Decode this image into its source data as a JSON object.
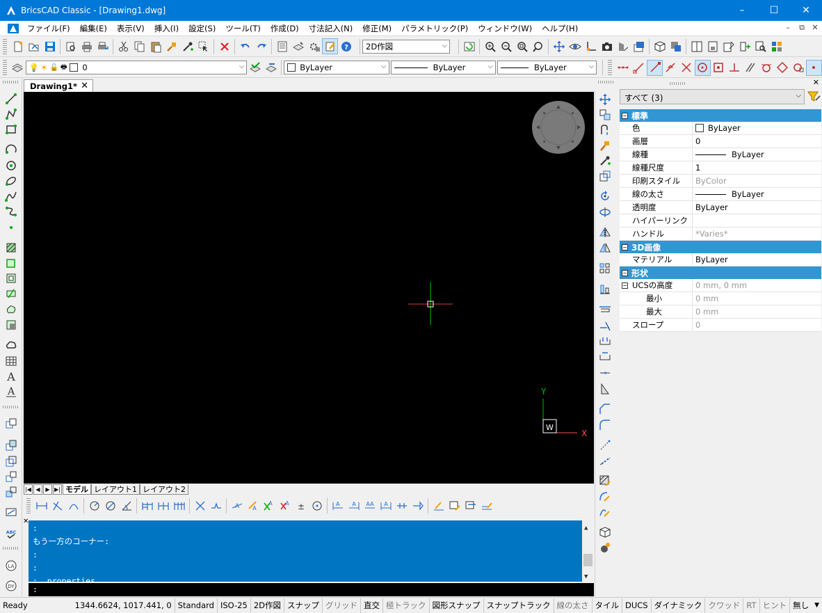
{
  "window": {
    "title": "BricsCAD Classic - [Drawing1.dwg]",
    "minimize": "–",
    "maximize": "☐",
    "close": "✕"
  },
  "menu": {
    "items": [
      "ファイル(F)",
      "編集(E)",
      "表示(V)",
      "挿入(I)",
      "設定(S)",
      "ツール(T)",
      "作成(D)",
      "寸法記入(N)",
      "修正(M)",
      "パラメトリック(P)",
      "ウィンドウ(W)",
      "ヘルプ(H)"
    ],
    "mdi_minimize": "–",
    "mdi_restore": "⧉",
    "mdi_close": "✕"
  },
  "toolbar": {
    "workspace": "2D作図"
  },
  "layerbar": {
    "layer": "0",
    "color": "ByLayer",
    "linetype": "ByLayer",
    "lineweight": "ByLayer"
  },
  "document": {
    "tab": "Drawing1*",
    "close": "✕"
  },
  "ucs": {
    "y": "Y",
    "x": "X",
    "w": "W"
  },
  "layout_tabs": {
    "nav": [
      "|◀",
      "◀",
      "▶",
      "▶|"
    ],
    "tabs": [
      "モデル",
      "レイアウト1",
      "レイアウト2"
    ]
  },
  "command": {
    "lines": [
      ":",
      "もう一方のコーナー:",
      ":",
      ":",
      ": _properties"
    ],
    "prompt": ":"
  },
  "status": {
    "ready": "Ready",
    "coords": "1344.6624, 1017.441, 0",
    "items": [
      {
        "label": "Standard",
        "on": true
      },
      {
        "label": "ISO-25",
        "on": true
      },
      {
        "label": "2D作図",
        "on": true
      },
      {
        "label": "スナップ",
        "on": true
      },
      {
        "label": "グリッド",
        "on": false
      },
      {
        "label": "直交",
        "on": true
      },
      {
        "label": "極トラック",
        "on": false
      },
      {
        "label": "図形スナップ",
        "on": true
      },
      {
        "label": "スナップトラック",
        "on": true
      },
      {
        "label": "線の太さ",
        "on": false
      },
      {
        "label": "タイル",
        "on": true
      },
      {
        "label": "DUCS",
        "on": true
      },
      {
        "label": "ダイナミック",
        "on": true
      },
      {
        "label": "クワッド",
        "on": false
      },
      {
        "label": "RT",
        "on": false
      },
      {
        "label": "ヒント",
        "on": false
      },
      {
        "label": "無し",
        "on": true
      }
    ]
  },
  "properties": {
    "close": "✕",
    "selection": "すべて (3)",
    "categories": [
      {
        "name": "標準",
        "rows": [
          {
            "key": "色",
            "value": "ByLayer",
            "swatch": true
          },
          {
            "key": "画層",
            "value": "0"
          },
          {
            "key": "線種",
            "value": "ByLayer",
            "line": true
          },
          {
            "key": "線種尺度",
            "value": "1"
          },
          {
            "key": "印刷スタイル",
            "value": "ByColor",
            "gray": true
          },
          {
            "key": "線の太さ",
            "value": "ByLayer",
            "line": true
          },
          {
            "key": "透明度",
            "value": "ByLayer"
          },
          {
            "key": "ハイパーリンク",
            "value": ""
          },
          {
            "key": "ハンドル",
            "value": "*Varies*",
            "gray": true
          }
        ]
      },
      {
        "name": "3D画像",
        "rows": [
          {
            "key": "マテリアル",
            "value": "ByLayer"
          }
        ]
      },
      {
        "name": "形状",
        "rows": [
          {
            "key": "UCSの高度",
            "value": "0 mm, 0 mm",
            "gray": true,
            "toggle": true
          },
          {
            "key": "最小",
            "value": "0 mm",
            "gray": true,
            "sub": true
          },
          {
            "key": "最大",
            "value": "0 mm",
            "gray": true,
            "sub": true
          },
          {
            "key": "スロープ",
            "value": "0",
            "gray": true
          }
        ]
      }
    ]
  },
  "colors": {
    "title_bar": "#0078d7",
    "command_bg": "#0075c2",
    "category_bg": "#3296d2",
    "canvas": "#000000",
    "nav_wheel": "#7a7a7a",
    "ucs_axis": "#ff5050",
    "crosshair_v": "#00c000",
    "crosshair_h": "#d04040"
  }
}
